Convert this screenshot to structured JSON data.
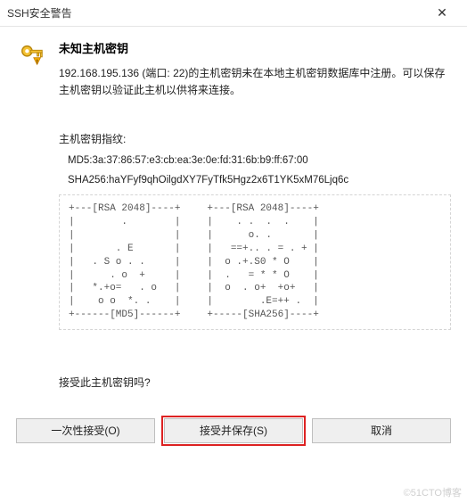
{
  "titlebar": {
    "title": "SSH安全警告"
  },
  "dialog": {
    "heading": "未知主机密钥",
    "message": "192.168.195.136 (端口: 22)的主机密钥未在本地主机密钥数据库中注册。可以保存主机密钥以验证此主机以供将来连接。"
  },
  "fingerprint": {
    "label": "主机密钥指纹:",
    "md5": "MD5:3a:37:86:57:e3:cb:ea:3e:0e:fd:31:6b:b9:ff:67:00",
    "sha256": "SHA256:haYFyf9qhOilgdXY7FyTfk5Hgz2x6T1YK5xM76Ljq6c"
  },
  "ascii": {
    "rsa": "+---[RSA 2048]----+\n|        .        |\n|                 |\n|       . E       |\n|   . S o . .     |\n|      . o  +     |\n|   *.+o=   . o   |\n|    o o  *. .    |\n+------[MD5]------+",
    "sha": "+---[RSA 2048]----+\n|    . .  .  .    |\n|      o. .       |\n|   ==+.. . = . + |\n|  o .+.S0 * O    |\n|  .   = * * O    |\n|  o  . o+  +o+   |\n|        .E=++ .  |\n+-----[SHA256]----+"
  },
  "confirm": {
    "label": "接受此主机密钥吗?"
  },
  "buttons": {
    "once": "一次性接受(O)",
    "accept_save": "接受并保存(S)",
    "cancel": "取消"
  },
  "watermark": "©51CTO博客",
  "icons": {
    "close": "✕"
  }
}
